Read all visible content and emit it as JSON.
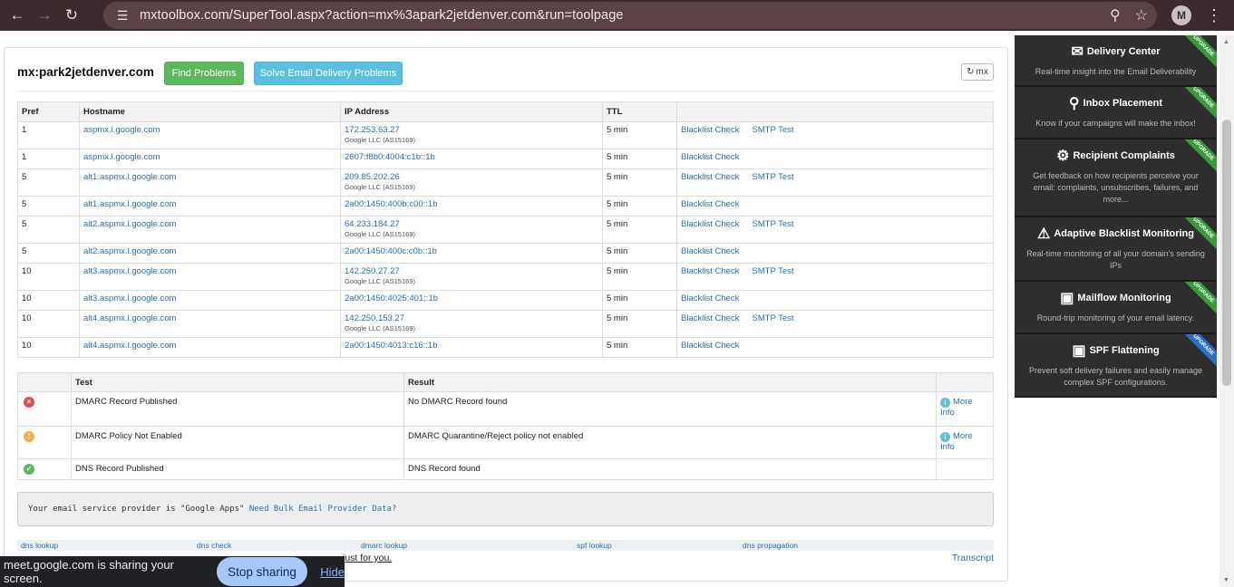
{
  "browser": {
    "url": "mxtoolbox.com/SuperTool.aspx?action=mx%3apark2jetdenver.com&run=toolpage",
    "avatar_letter": "M"
  },
  "panel": {
    "title": "mx:park2jetdenver.com",
    "find_problems": "Find Problems",
    "solve_delivery": "Solve Email Delivery Problems",
    "refresh_label": "mx"
  },
  "mx_table": {
    "headers": [
      "Pref",
      "Hostname",
      "IP Address",
      "TTL",
      ""
    ],
    "rows": [
      {
        "pref": "1",
        "host": "aspmx.l.google.com",
        "ip": "172.253.63.27",
        "asn": "Google LLC (AS15169)",
        "ttl": "5 min",
        "blacklist": "Blacklist Check",
        "smtp": "SMTP Test"
      },
      {
        "pref": "1",
        "host": "aspmx.l.google.com",
        "ip": "2607:f8b0:4004:c1b::1b",
        "asn": "",
        "ttl": "5 min",
        "blacklist": "Blacklist Check",
        "smtp": ""
      },
      {
        "pref": "5",
        "host": "alt1.aspmx.l.google.com",
        "ip": "209.85.202.26",
        "asn": "Google LLC (AS15169)",
        "ttl": "5 min",
        "blacklist": "Blacklist Check",
        "smtp": "SMTP Test"
      },
      {
        "pref": "5",
        "host": "alt1.aspmx.l.google.com",
        "ip": "2a00:1450:400b:c00::1b",
        "asn": "",
        "ttl": "5 min",
        "blacklist": "Blacklist Check",
        "smtp": ""
      },
      {
        "pref": "5",
        "host": "alt2.aspmx.l.google.com",
        "ip": "64.233.184.27",
        "asn": "Google LLC (AS15169)",
        "ttl": "5 min",
        "blacklist": "Blacklist Check",
        "smtp": "SMTP Test"
      },
      {
        "pref": "5",
        "host": "alt2.aspmx.l.google.com",
        "ip": "2a00:1450:400c:c0b::1b",
        "asn": "",
        "ttl": "5 min",
        "blacklist": "Blacklist Check",
        "smtp": ""
      },
      {
        "pref": "10",
        "host": "alt3.aspmx.l.google.com",
        "ip": "142.250.27.27",
        "asn": "Google LLC (AS15169)",
        "ttl": "5 min",
        "blacklist": "Blacklist Check",
        "smtp": "SMTP Test"
      },
      {
        "pref": "10",
        "host": "alt3.aspmx.l.google.com",
        "ip": "2a00:1450:4025:401::1b",
        "asn": "",
        "ttl": "5 min",
        "blacklist": "Blacklist Check",
        "smtp": ""
      },
      {
        "pref": "10",
        "host": "alt4.aspmx.l.google.com",
        "ip": "142.250.153.27",
        "asn": "Google LLC (AS15169)",
        "ttl": "5 min",
        "blacklist": "Blacklist Check",
        "smtp": "SMTP Test"
      },
      {
        "pref": "10",
        "host": "alt4.aspmx.l.google.com",
        "ip": "2a00:1450:4013:c16::1b",
        "asn": "",
        "ttl": "5 min",
        "blacklist": "Blacklist Check",
        "smtp": ""
      }
    ]
  },
  "test_table": {
    "headers": [
      "",
      "Test",
      "Result",
      ""
    ],
    "rows": [
      {
        "status": "error",
        "status_glyph": "×",
        "test": "DMARC Record Published",
        "result": "No DMARC Record found",
        "more": "More",
        "info": "Info"
      },
      {
        "status": "warning",
        "status_glyph": "!",
        "test": "DMARC Policy Not Enabled",
        "result": "DMARC Quarantine/Reject policy not enabled",
        "more": "More",
        "info": "Info"
      },
      {
        "status": "ok",
        "status_glyph": "✓",
        "test": "DNS Record Published",
        "result": "DNS Record found",
        "more": "",
        "info": ""
      }
    ]
  },
  "provider": {
    "text": "Your email service provider is \"Google Apps\"",
    "link": "Need Bulk Email Provider Data?"
  },
  "tool_links": [
    "dns lookup",
    "dns check",
    "dmarc lookup",
    "spf lookup",
    "dns propagation"
  ],
  "footer": {
    "just_for_you": "just for you.",
    "transcript": "Transcript"
  },
  "sidebar": [
    {
      "title": "Delivery Center",
      "icon": "mail-icon",
      "desc": "Real-time insight into the Email Deliverability",
      "ribbon": "UPGRADE",
      "ribbon_color": "#3a9a3a"
    },
    {
      "title": "Inbox Placement",
      "icon": "search-icon",
      "desc": "Know if your campaigns will make the inbox!",
      "ribbon": "UPGRADE",
      "ribbon_color": "#3a9a3a"
    },
    {
      "title": "Recipient Complaints",
      "icon": "gears-icon",
      "desc": "Get feedback on how recipients perceive your email: complaints, unsubscribes, failures, and more...",
      "ribbon": "UPGRADE",
      "ribbon_color": "#3a9a3a"
    },
    {
      "title": "Adaptive Blacklist Monitoring",
      "icon": "warning-icon",
      "desc": "Real-time monitoring of all your domain's sending IPs",
      "ribbon": "UPGRADE",
      "ribbon_color": "#3a9a3a"
    },
    {
      "title": "Mailflow Monitoring",
      "icon": "mailbox-icon",
      "desc": "Round-trip monitoring of your email latency.",
      "ribbon": "UPGRADE",
      "ribbon_color": "#3a9a3a"
    },
    {
      "title": "SPF Flattening",
      "icon": "mailbox-icon",
      "desc": "Prevent soft delivery failures and easily manage complex SPF configurations.",
      "ribbon": "UPGRADE",
      "ribbon_color": "#2b6fc9"
    }
  ],
  "share_bar": {
    "text": "meet.google.com is sharing your screen.",
    "stop": "Stop sharing",
    "hide": "Hide"
  }
}
